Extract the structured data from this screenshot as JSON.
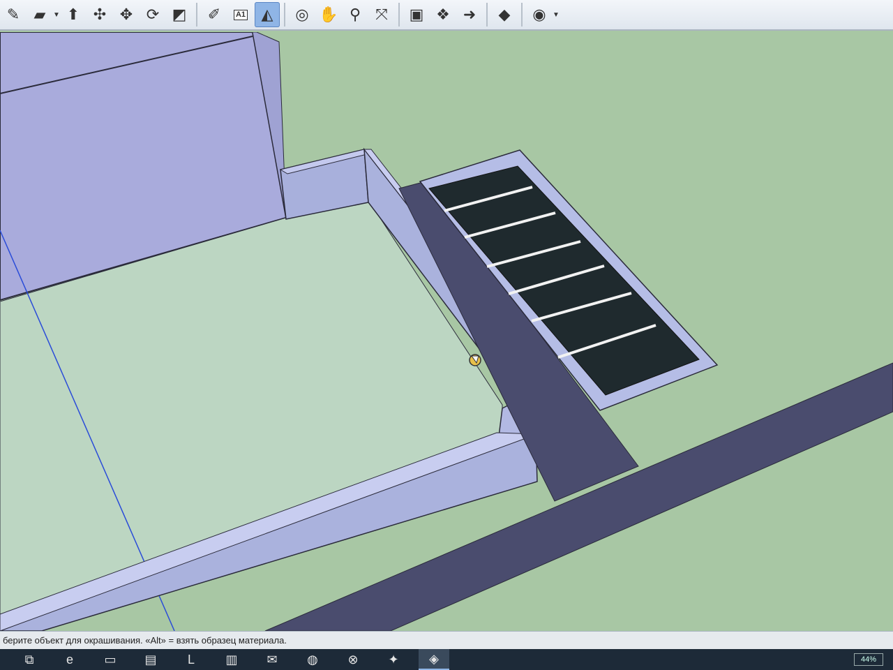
{
  "toolbar": {
    "tools": [
      {
        "name": "select-tool-icon",
        "glyph": "✎"
      },
      {
        "name": "eraser-tool-icon",
        "glyph": "▰"
      },
      {
        "name": "push-pull-tool-icon",
        "glyph": "⬆"
      },
      {
        "name": "follow-me-tool-icon",
        "glyph": "✣"
      },
      {
        "name": "move-tool-icon",
        "glyph": "✥"
      },
      {
        "name": "rotate-tool-icon",
        "glyph": "⟳"
      },
      {
        "name": "offset-tool-icon",
        "glyph": "◩"
      },
      {
        "name": "tape-measure-tool-icon",
        "glyph": "✐"
      },
      {
        "name": "text-tool-icon",
        "glyph": "A1"
      },
      {
        "name": "paint-bucket-tool-icon",
        "glyph": "◭"
      },
      {
        "name": "orbit-tool-icon",
        "glyph": "◎"
      },
      {
        "name": "pan-tool-icon",
        "glyph": "✋"
      },
      {
        "name": "zoom-tool-icon",
        "glyph": "⚲"
      },
      {
        "name": "zoom-extents-tool-icon",
        "glyph": "⤧"
      },
      {
        "name": "3d-warehouse-icon",
        "glyph": "▣"
      },
      {
        "name": "extension-warehouse-icon",
        "glyph": "❖"
      },
      {
        "name": "layout-send-icon",
        "glyph": "➜"
      },
      {
        "name": "ruby-extension-icon",
        "glyph": "◆"
      },
      {
        "name": "account-icon",
        "glyph": "◉"
      }
    ],
    "active_tool": "paint-bucket-tool-icon"
  },
  "status": {
    "text": "берите объект для окрашивания. «Alt» = взять образец материала."
  },
  "taskbar": {
    "apps": [
      {
        "name": "task-view-icon",
        "glyph": "⧉"
      },
      {
        "name": "edge-browser-icon",
        "glyph": "e"
      },
      {
        "name": "file-explorer-icon",
        "glyph": "▭"
      },
      {
        "name": "store-icon",
        "glyph": "▤"
      },
      {
        "name": "app-l-icon",
        "glyph": "L"
      },
      {
        "name": "media-app-icon",
        "glyph": "▥"
      },
      {
        "name": "mail-icon",
        "glyph": "✉"
      },
      {
        "name": "chrome-browser-icon",
        "glyph": "◍"
      },
      {
        "name": "game-app-icon",
        "glyph": "⊗"
      },
      {
        "name": "star-app-icon",
        "glyph": "✦"
      },
      {
        "name": "sketchup-app-icon",
        "glyph": "◈"
      }
    ],
    "active_app": "sketchup-app-icon",
    "battery": "44%"
  },
  "colors": {
    "ground": "#a8c7a4",
    "platform": "#b8d3bd",
    "wall_front": "#a8b0dc",
    "wall_top": "#c4c9ee",
    "walkway": "#4a4c6e",
    "court": "#1f2a2e",
    "court_lines": "#f2f2f2",
    "building": "#a9abdc"
  }
}
